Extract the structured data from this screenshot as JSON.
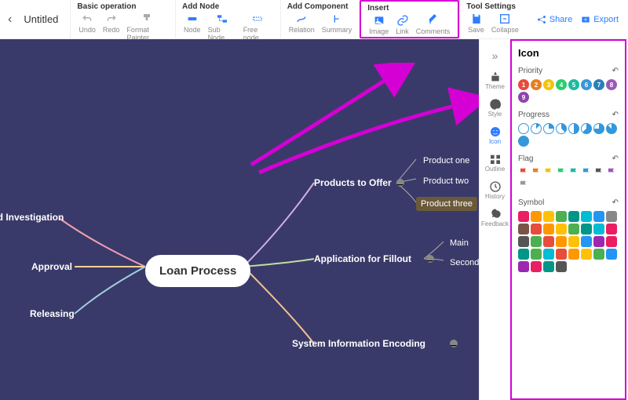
{
  "title": "Untitled",
  "toolbar": {
    "basic": {
      "h": "Basic operation",
      "undo": "Undo",
      "redo": "Redo",
      "fp": "Format Painter"
    },
    "add": {
      "h": "Add Node",
      "node": "Node",
      "sub": "Sub Node",
      "free": "Free node"
    },
    "comp": {
      "h": "Add Component",
      "rel": "Relation",
      "sum": "Summary"
    },
    "ins": {
      "h": "Insert",
      "img": "Image",
      "link": "Link",
      "com": "Comments"
    },
    "tool": {
      "h": "Tool Settings",
      "save": "Save",
      "col": "Collapse"
    }
  },
  "topRight": {
    "share": "Share",
    "export": "Export"
  },
  "mind": {
    "center": "Loan Process",
    "left": [
      "round Investigation",
      "Approval",
      "Releasing"
    ],
    "right": [
      "Products to Offer",
      "Application for Fillout",
      "System Information Encoding"
    ],
    "prod": [
      "Product one",
      "Product two",
      "Product three"
    ],
    "app": [
      "Main",
      "Secondary"
    ]
  },
  "side": {
    "theme": "Theme",
    "style": "Style",
    "icon": "Icon",
    "outline": "Outline",
    "history": "History",
    "feedback": "Feedback"
  },
  "panel": {
    "title": "Icon",
    "priority": "Priority",
    "progress": "Progress",
    "flag": "Flag",
    "symbol": "Symbol",
    "pcolors": [
      "#e74c3c",
      "#e67e22",
      "#f1c40f",
      "#2ecc71",
      "#1abc9c",
      "#3498db",
      "#2980b9",
      "#9b59b6",
      "#8e44ad"
    ],
    "fcolors": [
      "#e74c3c",
      "#e67e22",
      "#f1c40f",
      "#2ecc71",
      "#1abc9c",
      "#3498db",
      "#555",
      "#9b59b6",
      "#999"
    ],
    "scolors": [
      "#e91e63",
      "#ff9800",
      "#ffc107",
      "#4caf50",
      "#009688",
      "#00bcd4",
      "#2196f3",
      "#888",
      "#795548",
      "#e74c3c",
      "#ff9800",
      "#ffc107",
      "#4caf50",
      "#009688",
      "#00bcd4",
      "#e91e63",
      "#555",
      "#4caf50",
      "#e74c3c",
      "#ff9800",
      "#ffc107",
      "#2196f3",
      "#9c27b0",
      "#e91e63",
      "#009688",
      "#4caf50",
      "#00bcd4",
      "#e74c3c",
      "#ff9800",
      "#ffc107",
      "#4caf50",
      "#2196f3",
      "#9c27b0",
      "#e91e63",
      "#009688",
      "#555"
    ]
  }
}
